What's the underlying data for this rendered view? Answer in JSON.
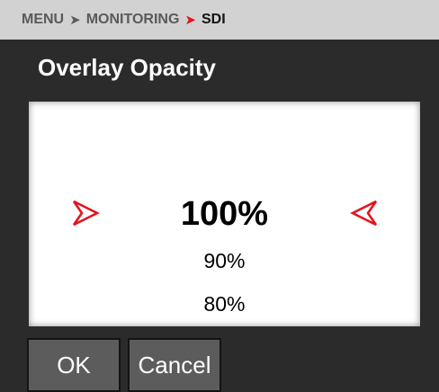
{
  "breadcrumb": {
    "items": [
      "MENU",
      "MONITORING",
      "SDI"
    ]
  },
  "dialog": {
    "title": "Overlay Opacity"
  },
  "picker": {
    "selected": "100%",
    "options_below": [
      "90%",
      "80%"
    ]
  },
  "buttons": {
    "ok": "OK",
    "cancel": "Cancel"
  },
  "icons": {
    "breadcrumb_separator": "chevron-right-icon",
    "active_separator": "red-chevron-right-icon",
    "left_selector": "red-chevron-right-outline-icon",
    "right_selector": "red-chevron-left-outline-icon"
  },
  "colors": {
    "accent": "#e0161e",
    "background": "#2b2b2b",
    "breadcrumb_bg": "#d2d2d2",
    "button_bg": "#5c5c5c"
  }
}
